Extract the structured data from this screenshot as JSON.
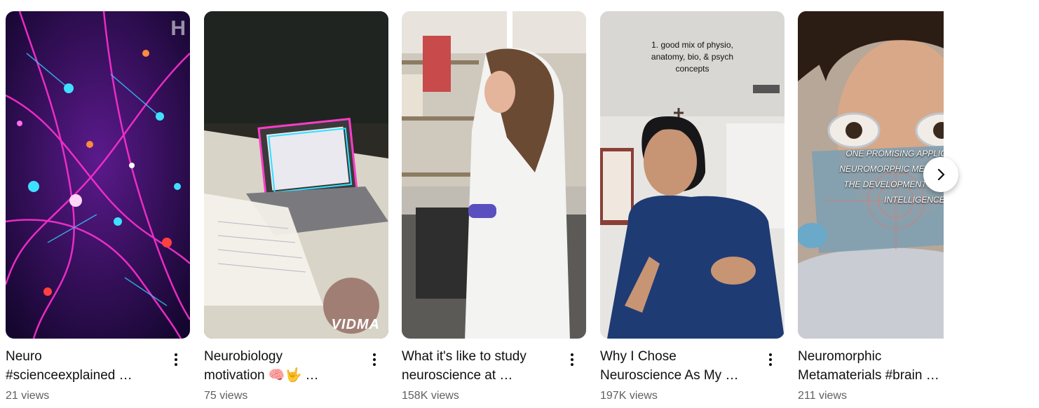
{
  "shorts": [
    {
      "title": "Neuro\n#scienceexplained …",
      "views": "21 views",
      "watermark": "H"
    },
    {
      "title": "Neurobiology\nmotivation 🧠🤟  …",
      "views": "75 views",
      "watermark": "VIDMA"
    },
    {
      "title": "What it's like to study\nneuroscience at …",
      "views": "158K views"
    },
    {
      "title": "Why I Chose\nNeuroscience As My …",
      "views": "197K views",
      "overlay": "1. good mix of physio,\nanatomy, bio, & psych\nconcepts"
    },
    {
      "title": "Neuromorphic\nMetamaterials #brain …",
      "views": "211 views",
      "overlay": "ONE PROMISING APPLICATION OF\nNEUROMORPHIC METAMATERIALS IS\nTHE DEVELOPMENT OF ARTIFICIAL\nINTELLIGENCE."
    }
  ],
  "icons": {
    "more": "more-vert-icon",
    "next": "chevron-right-icon"
  }
}
